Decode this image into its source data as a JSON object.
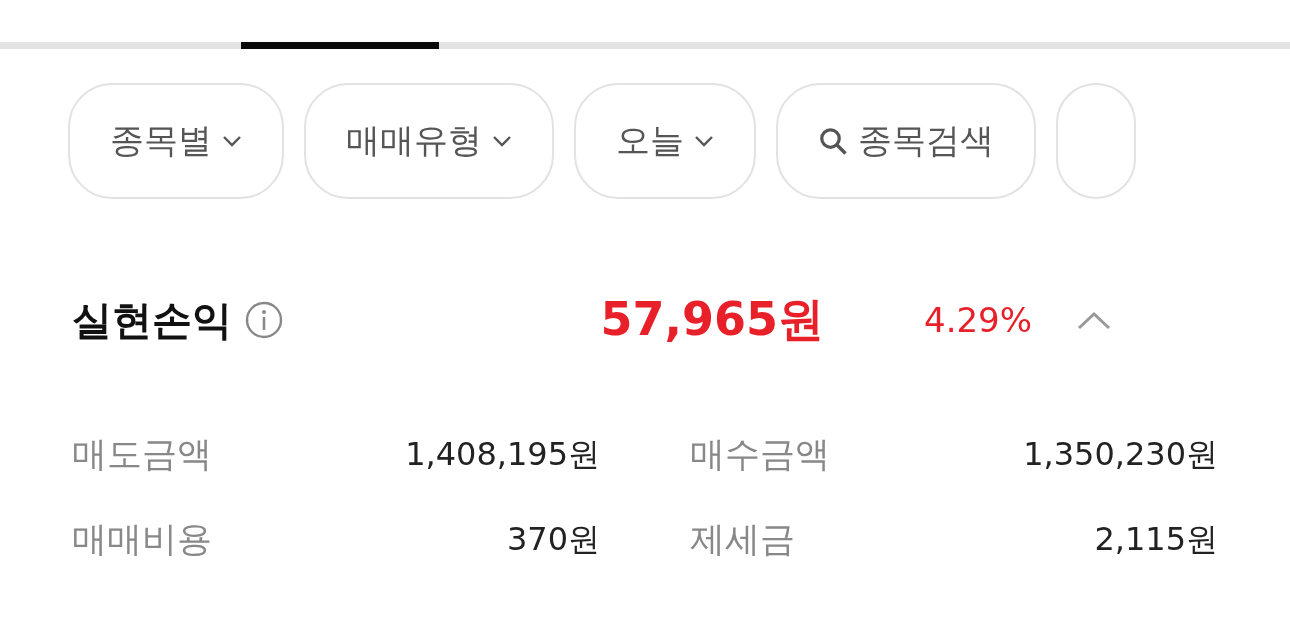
{
  "indicator": {
    "segments": [
      {
        "selected": false
      },
      {
        "selected": true
      },
      {
        "selected": false
      },
      {
        "selected": false
      },
      {
        "selected": false
      },
      {
        "selected": false
      }
    ]
  },
  "filters": [
    {
      "kind": "dropdown",
      "label": "종목별"
    },
    {
      "kind": "dropdown",
      "label": "매매유형"
    },
    {
      "kind": "dropdown",
      "label": "오늘"
    },
    {
      "kind": "search",
      "label": "종목검색"
    },
    {
      "kind": "partial"
    }
  ],
  "summary": {
    "title": "실현손익",
    "amount": "57,965원",
    "rate": "4.29%",
    "expanded": true
  },
  "details": [
    {
      "label": "매도금액",
      "value": "1,408,195원"
    },
    {
      "label": "매수금액",
      "value": "1,350,230원"
    },
    {
      "label": "매매비용",
      "value": "370원"
    },
    {
      "label": "제세금",
      "value": "2,115원"
    }
  ]
}
